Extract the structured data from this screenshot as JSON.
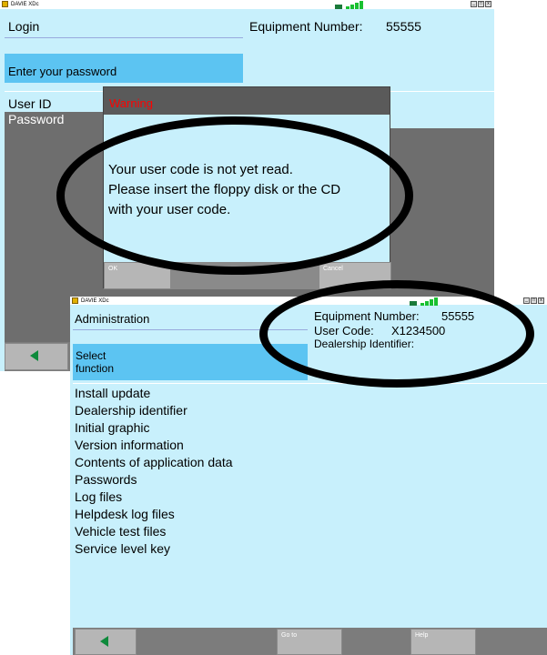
{
  "login_window": {
    "app_title": "DAVIE XDc",
    "screen_title": "Login",
    "prompt": "Enter your password",
    "equipment_label": "Equipment Number:",
    "equipment_value": "55555",
    "fields": [
      "User ID",
      "Password"
    ]
  },
  "warning_dialog": {
    "title": "Warning",
    "lines": [
      "Your user code is not yet read.",
      "Please insert the floppy disk or the CD",
      "with your user code."
    ],
    "ok_label": "OK",
    "cancel_label": "Cancel",
    "title_color": "#ff0000"
  },
  "admin_window": {
    "app_title": "DAVIE XDc",
    "screen_title": "Administration",
    "select_label": "Select\nfunction",
    "equipment_label": "Equipment Number:",
    "equipment_value": "55555",
    "user_code_label": "User Code:",
    "user_code_value": "X1234500",
    "dealership_label": "Dealership Identifier:",
    "menu": [
      "Install update",
      "Dealership identifier",
      "Initial graphic",
      "Version information",
      "Contents of application data",
      "Passwords",
      "Log files",
      "Helpdesk log files",
      "Vehicle test files",
      "Service level key"
    ],
    "goto_label": "Go to",
    "help_label": "Help"
  },
  "colors": {
    "panel": "#c8f0fc",
    "highlight": "#5cc4f2",
    "toolbar": "#7c7c7c",
    "arrow": "#0e8a3c",
    "annotation": "#000000"
  }
}
